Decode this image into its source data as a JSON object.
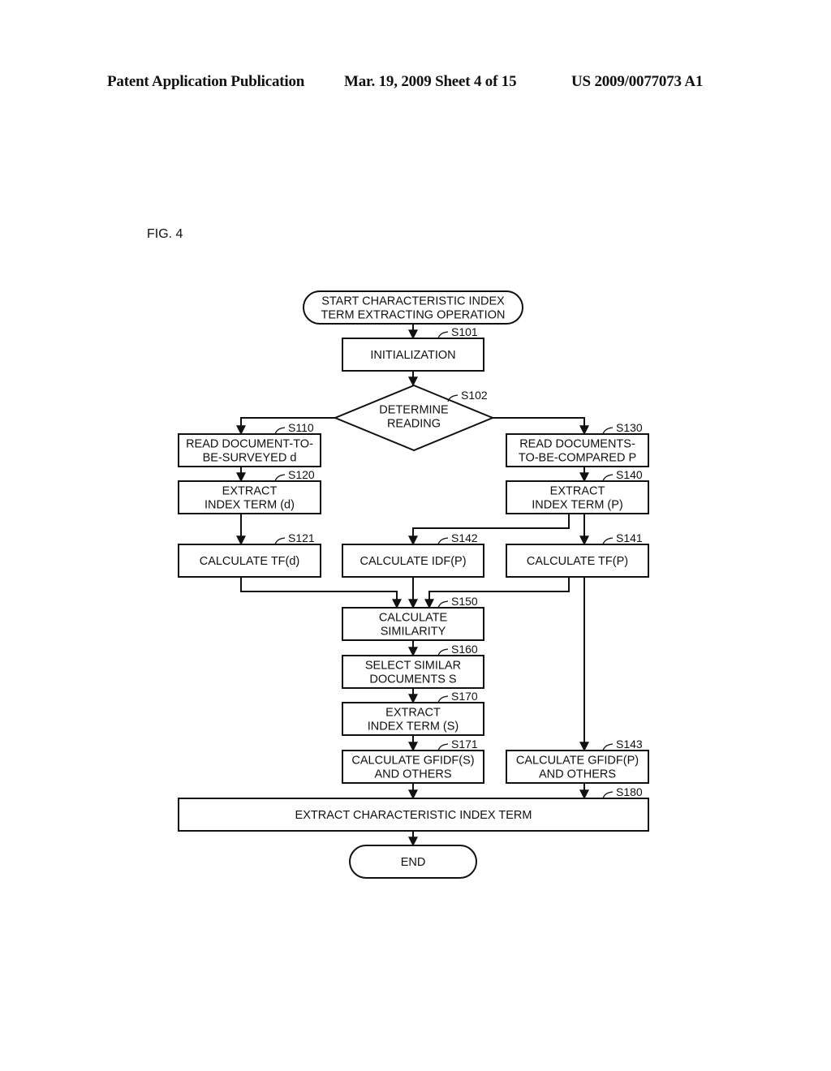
{
  "header": {
    "publication": "Patent Application Publication",
    "date_sheet": "Mar. 19, 2009  Sheet 4 of 15",
    "number": "US 2009/0077073 A1"
  },
  "figure": {
    "label": "FIG. 4"
  },
  "flowchart": {
    "start": {
      "lines": [
        "START CHARACTERISTIC INDEX",
        "TERM EXTRACTING OPERATION"
      ]
    },
    "nodes": {
      "s101": {
        "step": "S101",
        "lines": [
          "INITIALIZATION"
        ]
      },
      "s102": {
        "step": "S102",
        "lines": [
          "DETERMINE",
          "READING"
        ]
      },
      "s110": {
        "step": "S110",
        "lines": [
          "READ DOCUMENT-TO-",
          "BE-SURVEYED d"
        ]
      },
      "s120": {
        "step": "S120",
        "lines": [
          "EXTRACT",
          "INDEX TERM (d)"
        ]
      },
      "s121": {
        "step": "S121",
        "lines": [
          "CALCULATE TF(d)"
        ]
      },
      "s130": {
        "step": "S130",
        "lines": [
          "READ DOCUMENTS-",
          "TO-BE-COMPARED P"
        ]
      },
      "s140": {
        "step": "S140",
        "lines": [
          "EXTRACT",
          "INDEX TERM (P)"
        ]
      },
      "s141": {
        "step": "S141",
        "lines": [
          "CALCULATE TF(P)"
        ]
      },
      "s142": {
        "step": "S142",
        "lines": [
          "CALCULATE IDF(P)"
        ]
      },
      "s143": {
        "step": "S143",
        "lines": [
          "CALCULATE GFIDF(P)",
          "AND OTHERS"
        ]
      },
      "s150": {
        "step": "S150",
        "lines": [
          "CALCULATE",
          "SIMILARITY"
        ]
      },
      "s160": {
        "step": "S160",
        "lines": [
          "SELECT SIMILAR",
          "DOCUMENTS S"
        ]
      },
      "s170": {
        "step": "S170",
        "lines": [
          "EXTRACT",
          "INDEX TERM (S)"
        ]
      },
      "s171": {
        "step": "S171",
        "lines": [
          "CALCULATE GFIDF(S)",
          "AND OTHERS"
        ]
      },
      "s180": {
        "step": "S180",
        "lines": [
          "EXTRACT CHARACTERISTIC INDEX TERM"
        ]
      }
    },
    "end": {
      "lines": [
        "END"
      ]
    },
    "edges": [
      [
        "start",
        "s101"
      ],
      [
        "s101",
        "s102"
      ],
      [
        "s102",
        "s110"
      ],
      [
        "s102",
        "s130"
      ],
      [
        "s110",
        "s120"
      ],
      [
        "s120",
        "s121"
      ],
      [
        "s130",
        "s140"
      ],
      [
        "s140",
        "s142"
      ],
      [
        "s140",
        "s141"
      ],
      [
        "s121",
        "s150"
      ],
      [
        "s142",
        "s150"
      ],
      [
        "s141",
        "s150"
      ],
      [
        "s141",
        "s143"
      ],
      [
        "s150",
        "s160"
      ],
      [
        "s160",
        "s170"
      ],
      [
        "s170",
        "s171"
      ],
      [
        "s171",
        "s180"
      ],
      [
        "s143",
        "s180"
      ],
      [
        "s180",
        "end"
      ]
    ]
  }
}
